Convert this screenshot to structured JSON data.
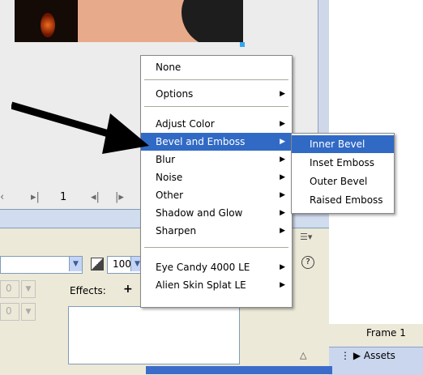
{
  "timeline": {
    "frame_number": "1"
  },
  "properties": {
    "opacity": "100",
    "x_value": "0",
    "y_value": "0",
    "effects_label": "Effects:",
    "effects_add": "+"
  },
  "main_menu": {
    "items": [
      {
        "label": "None",
        "has_submenu": false
      },
      {
        "label": "Options",
        "has_submenu": true
      },
      {
        "label": "Adjust Color",
        "has_submenu": true
      },
      {
        "label": "Bevel and Emboss",
        "has_submenu": true,
        "highlighted": true
      },
      {
        "label": "Blur",
        "has_submenu": true
      },
      {
        "label": "Noise",
        "has_submenu": true
      },
      {
        "label": "Other",
        "has_submenu": true
      },
      {
        "label": "Shadow and Glow",
        "has_submenu": true
      },
      {
        "label": "Sharpen",
        "has_submenu": true
      },
      {
        "label": "Eye Candy 4000 LE",
        "has_submenu": true
      },
      {
        "label": "Alien Skin Splat LE",
        "has_submenu": true
      }
    ]
  },
  "sub_menu": {
    "items": [
      {
        "label": "Inner Bevel",
        "highlighted": true
      },
      {
        "label": "Inset Emboss"
      },
      {
        "label": "Outer Bevel"
      },
      {
        "label": "Raised Emboss"
      }
    ]
  },
  "right_panel": {
    "frame_label": "Frame 1",
    "assets_label": "Assets"
  },
  "colors": {
    "menu_highlight": "#316ac5",
    "panel_header": "#d1dcef"
  }
}
